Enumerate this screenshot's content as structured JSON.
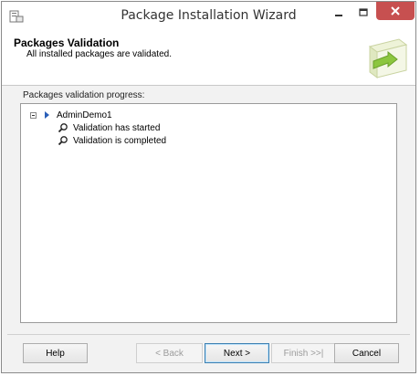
{
  "window": {
    "title": "Package Installation Wizard",
    "colors": {
      "close_button": "#c75050",
      "accent": "#2a5fb8"
    }
  },
  "header": {
    "title": "Packages Validation",
    "subtitle": "All installed packages are validated."
  },
  "progress": {
    "label": "Packages validation progress:",
    "tree": {
      "root": {
        "label": "AdminDemo1",
        "expanded": true
      },
      "children": [
        {
          "label": "Validation has started",
          "icon": "magnifier-icon"
        },
        {
          "label": "Validation is completed",
          "icon": "magnifier-icon"
        }
      ]
    }
  },
  "buttons": {
    "help": "Help",
    "back": "< Back",
    "next": "Next >",
    "finish": "Finish >>|",
    "cancel": "Cancel"
  }
}
